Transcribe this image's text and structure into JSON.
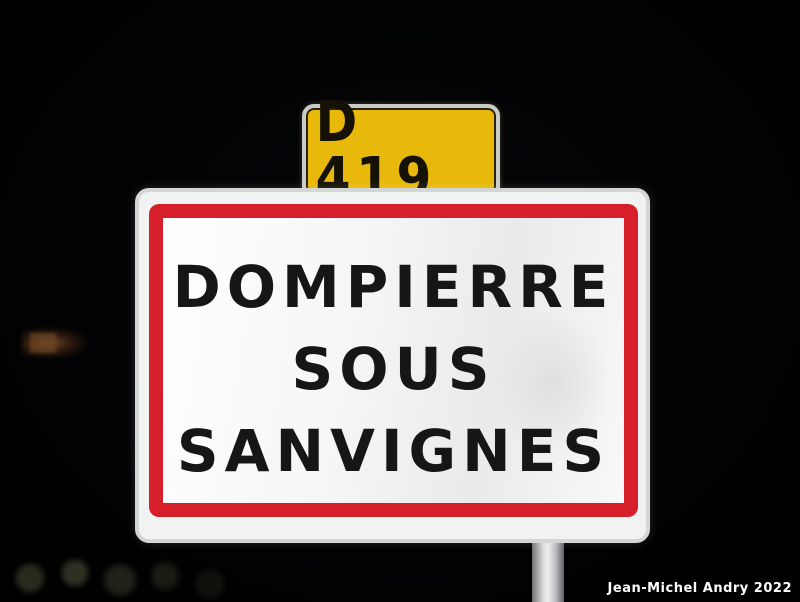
{
  "route_plate": {
    "text": "D 419",
    "background_color": "#e8b90a"
  },
  "town_sign": {
    "lines": [
      "DOMPIERRE",
      "SOUS",
      "SANVIGNES"
    ],
    "border_color": "#d61f2a",
    "background_color": "#ffffff"
  },
  "credit": {
    "text": "Jean-Michel Andry 2022"
  }
}
